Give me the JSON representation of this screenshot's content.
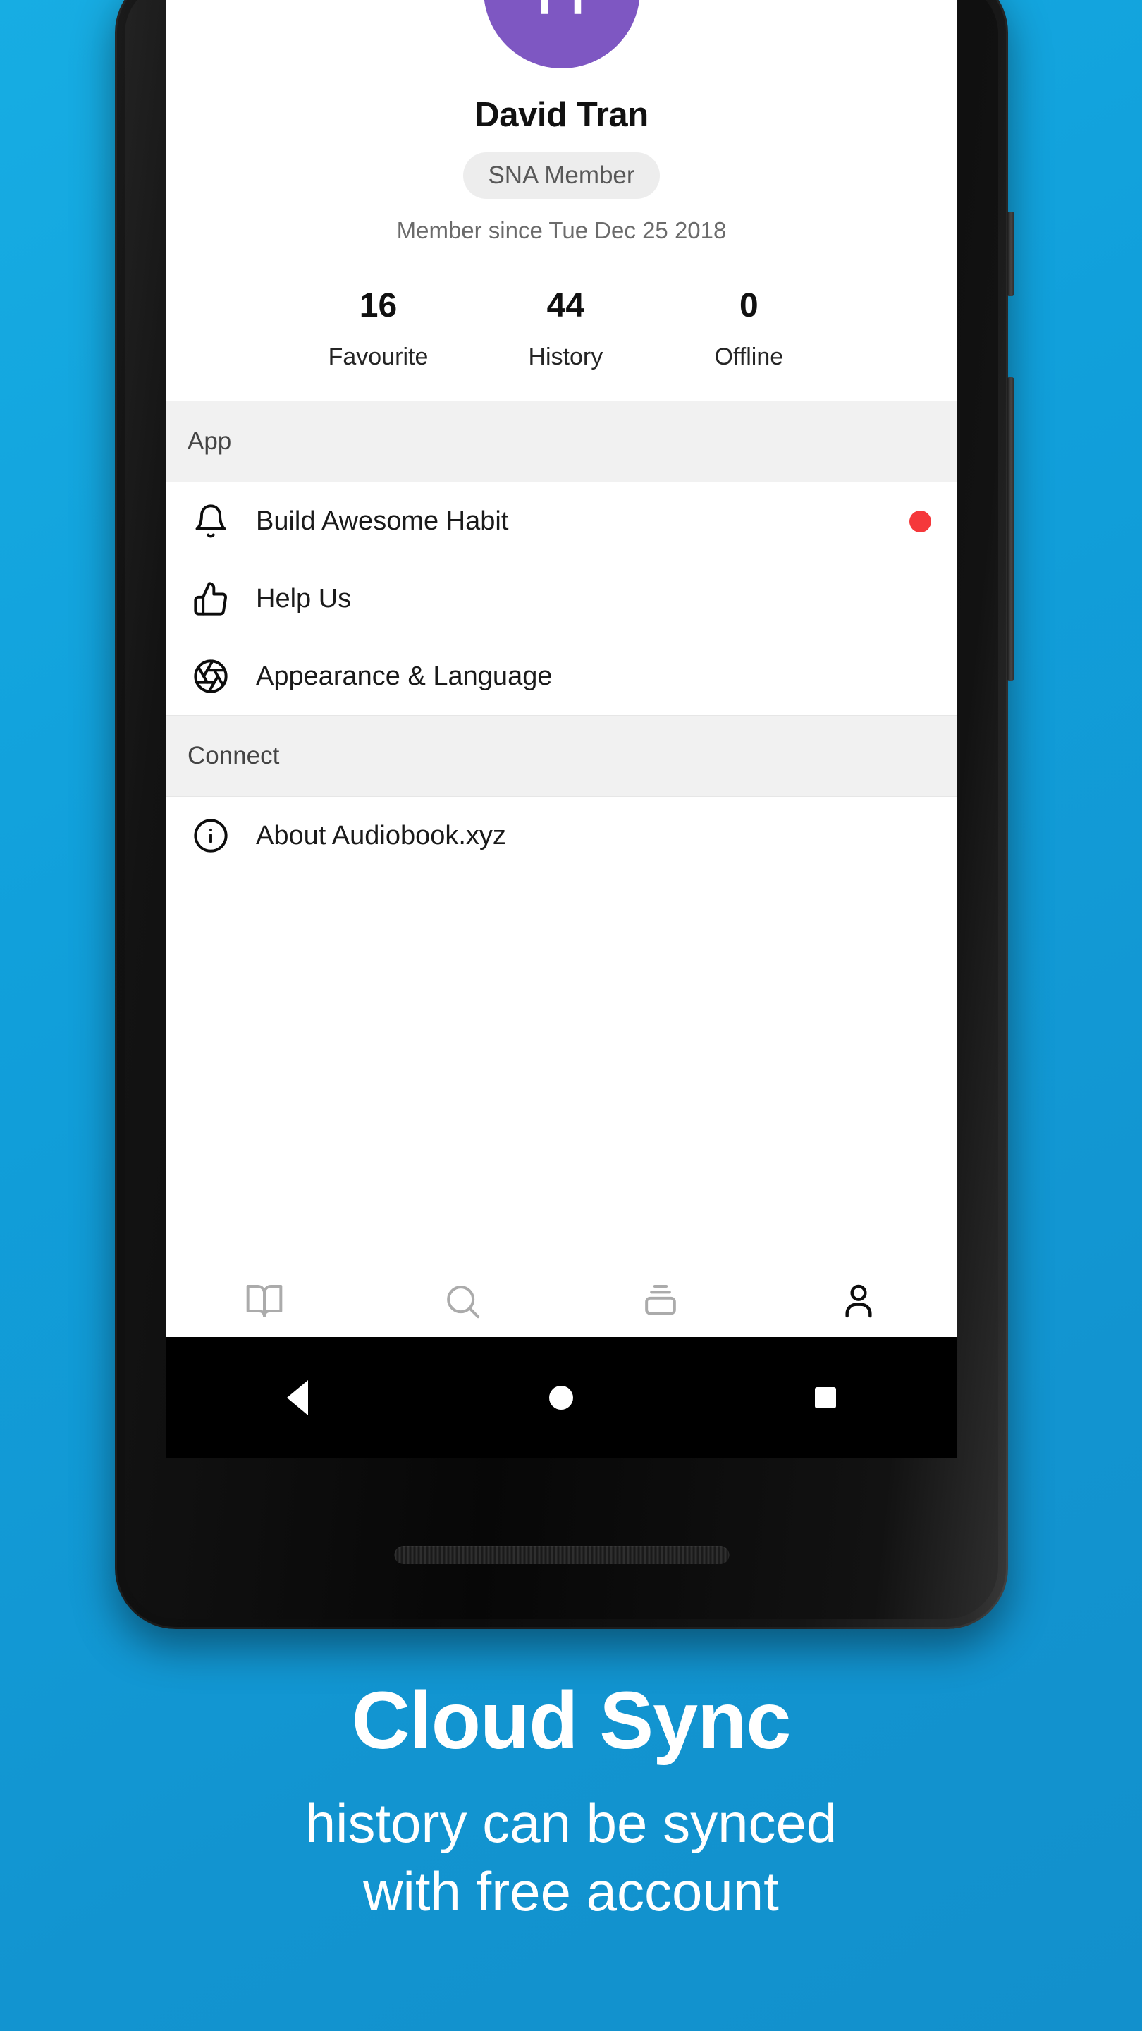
{
  "background": {
    "color_top": "#17ADE3",
    "color_bottom": "#1290CC"
  },
  "phone": {
    "buttons": {
      "power": "power-button",
      "volume": "volume-rocker"
    },
    "system_nav": {
      "back": "back-triangle",
      "home": "home-circle",
      "recents": "recents-square"
    }
  },
  "profile": {
    "avatar_initial": "H",
    "avatar_color": "#7E57C2",
    "name": "David Tran",
    "badge": "SNA Member",
    "member_since": "Member since Tue Dec 25 2018",
    "stats": [
      {
        "value": "16",
        "label": "Favourite"
      },
      {
        "value": "44",
        "label": "History"
      },
      {
        "value": "0",
        "label": "Offline"
      }
    ]
  },
  "sections": [
    {
      "header": "App",
      "items": [
        {
          "label": "Build Awesome Habit",
          "icon": "bell-icon",
          "badge": true,
          "badge_color": "#F5383B"
        },
        {
          "label": "Help Us",
          "icon": "thumbs-up-icon",
          "badge": false
        },
        {
          "label": "Appearance & Language",
          "icon": "aperture-icon",
          "badge": false
        }
      ]
    },
    {
      "header": "Connect",
      "items": [
        {
          "label": "About Audiobook.xyz",
          "icon": "info-icon",
          "badge": false
        }
      ]
    }
  ],
  "bottom_nav": [
    {
      "name": "library",
      "icon": "book-open-icon",
      "active": false
    },
    {
      "name": "search",
      "icon": "search-icon",
      "active": false
    },
    {
      "name": "shelf",
      "icon": "archive-icon",
      "active": false
    },
    {
      "name": "profile",
      "icon": "person-icon",
      "active": true
    }
  ],
  "promo": {
    "title": "Cloud Sync",
    "subtitle_line1": "history can be synced",
    "subtitle_line2": "with free account"
  }
}
